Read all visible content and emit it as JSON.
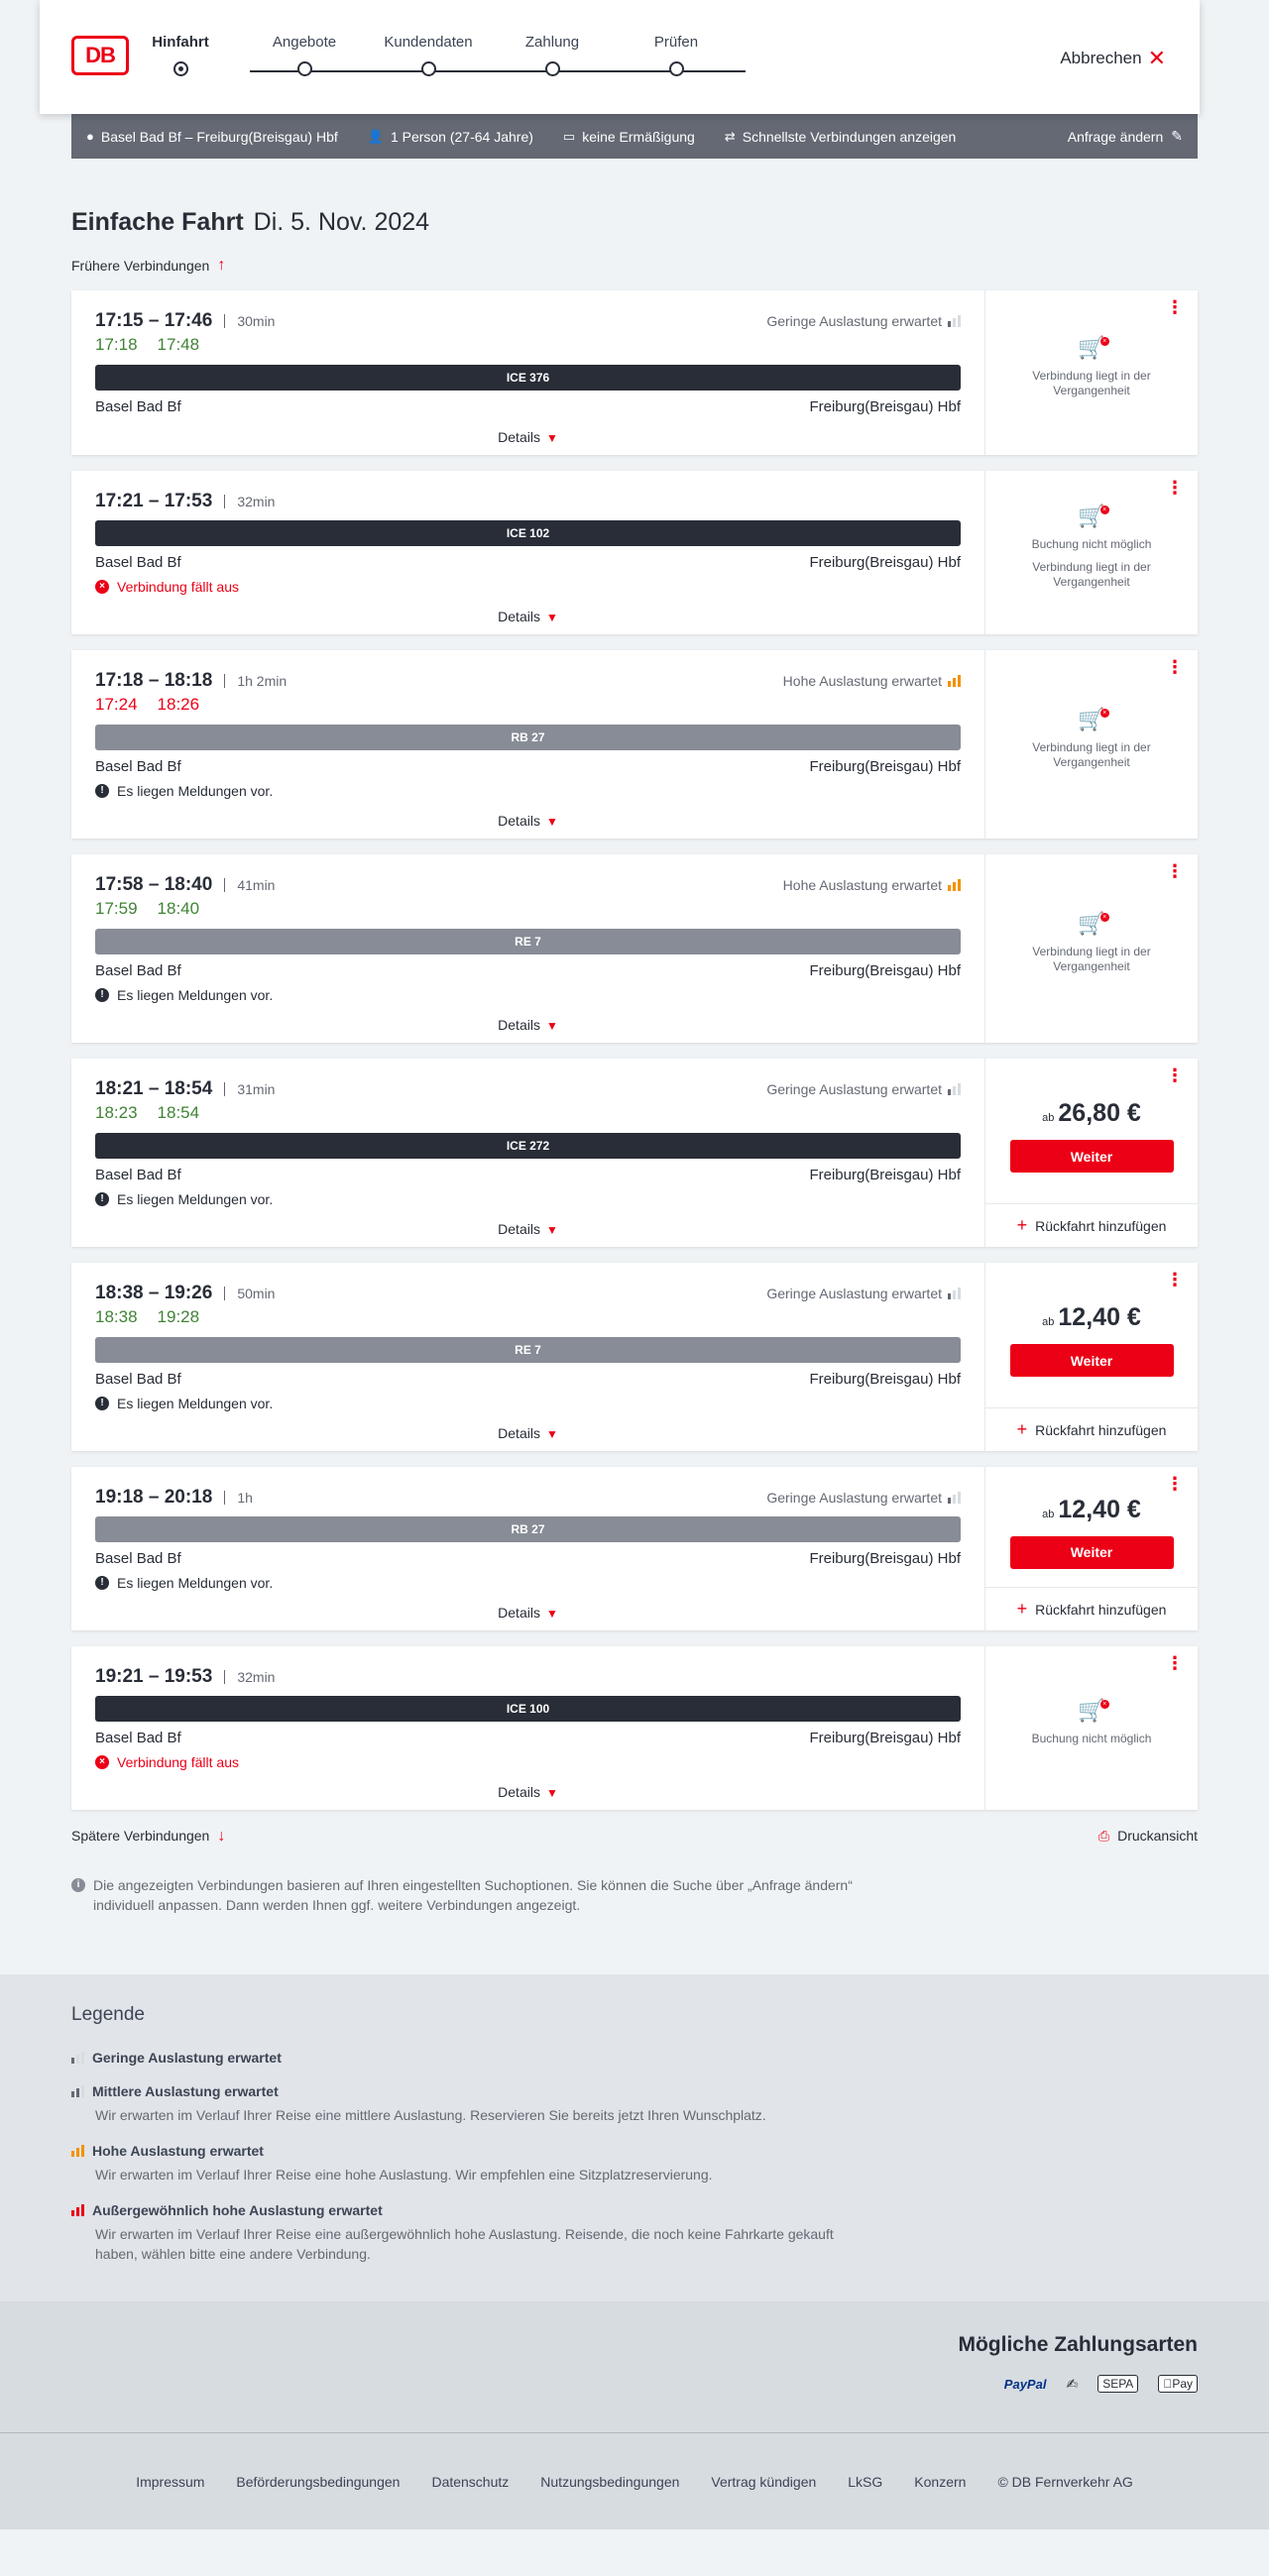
{
  "header": {
    "logo": "DB",
    "steps": [
      "Hinfahrt",
      "Angebote",
      "Kundendaten",
      "Zahlung",
      "Prüfen"
    ],
    "active_step": 0,
    "cancel_label": "Abbrechen"
  },
  "searchbar": {
    "route": "Basel Bad Bf – Freiburg(Breisgau) Hbf",
    "passengers": "1 Person (27-64 Jahre)",
    "discount": "keine Ermäßigung",
    "fastest": "Schnellste Verbindungen anzeigen",
    "change": "Anfrage ändern"
  },
  "title": {
    "type": "Einfache Fahrt",
    "date": "Di. 5. Nov. 2024"
  },
  "earlier_label": "Frühere Verbindungen",
  "later_label": "Spätere Verbindungen",
  "print_label": "Druckansicht",
  "connections": [
    {
      "times": "17:15 – 17:46",
      "duration": "30min",
      "load": "Geringe Auslastung erwartet",
      "load_level": "low",
      "rt_status": "ok",
      "rt_dep": "17:18",
      "rt_arr": "17:48",
      "train": "ICE 376",
      "train_type": "ice",
      "from": "Basel Bad Bf",
      "to": "Freiburg(Breisgau) Hbf",
      "notice": "",
      "notice_type": "",
      "details": "Details",
      "status_lines": [
        "Verbindung liegt in der Vergangenheit"
      ],
      "price": "",
      "price_prefix": "",
      "button": "",
      "return_label": ""
    },
    {
      "times": "17:21 – 17:53",
      "duration": "32min",
      "load": "",
      "load_level": "",
      "rt_status": "",
      "rt_dep": "",
      "rt_arr": "",
      "train": "ICE 102",
      "train_type": "ice",
      "from": "Basel Bad Bf",
      "to": "Freiburg(Breisgau) Hbf",
      "notice": "Verbindung fällt aus",
      "notice_type": "cancel",
      "details": "Details",
      "status_lines": [
        "Buchung nicht möglich",
        "Verbindung liegt in der Vergangenheit"
      ],
      "price": "",
      "price_prefix": "",
      "button": "",
      "return_label": ""
    },
    {
      "times": "17:18 – 18:18",
      "duration": "1h 2min",
      "load": "Hohe Auslastung erwartet",
      "load_level": "high",
      "rt_status": "late",
      "rt_dep": "17:24",
      "rt_arr": "18:26",
      "train": "RB 27",
      "train_type": "reg",
      "from": "Basel Bad Bf",
      "to": "Freiburg(Breisgau) Hbf",
      "notice": "Es liegen Meldungen vor.",
      "notice_type": "info",
      "details": "Details",
      "status_lines": [
        "Verbindung liegt in der Vergangenheit"
      ],
      "price": "",
      "price_prefix": "",
      "button": "",
      "return_label": ""
    },
    {
      "times": "17:58 – 18:40",
      "duration": "41min",
      "load": "Hohe Auslastung erwartet",
      "load_level": "high",
      "rt_status": "ok",
      "rt_dep": "17:59",
      "rt_arr": "18:40",
      "train": "RE 7",
      "train_type": "reg",
      "from": "Basel Bad Bf",
      "to": "Freiburg(Breisgau) Hbf",
      "notice": "Es liegen Meldungen vor.",
      "notice_type": "info",
      "details": "Details",
      "status_lines": [
        "Verbindung liegt in der Vergangenheit"
      ],
      "price": "",
      "price_prefix": "",
      "button": "",
      "return_label": ""
    },
    {
      "times": "18:21 – 18:54",
      "duration": "31min",
      "load": "Geringe Auslastung erwartet",
      "load_level": "low",
      "rt_status": "ok",
      "rt_dep": "18:23",
      "rt_arr": "18:54",
      "train": "ICE 272",
      "train_type": "ice",
      "from": "Basel Bad Bf",
      "to": "Freiburg(Breisgau) Hbf",
      "notice": "Es liegen Meldungen vor.",
      "notice_type": "info",
      "details": "Details",
      "status_lines": [],
      "price": "26,80 €",
      "price_prefix": "ab",
      "button": "Weiter",
      "return_label": "Rückfahrt hinzufügen"
    },
    {
      "times": "18:38 – 19:26",
      "duration": "50min",
      "load": "Geringe Auslastung erwartet",
      "load_level": "low",
      "rt_status": "ok",
      "rt_dep": "18:38",
      "rt_arr": "19:28",
      "train": "RE 7",
      "train_type": "reg",
      "from": "Basel Bad Bf",
      "to": "Freiburg(Breisgau) Hbf",
      "notice": "Es liegen Meldungen vor.",
      "notice_type": "info",
      "details": "Details",
      "status_lines": [],
      "price": "12,40 €",
      "price_prefix": "ab",
      "button": "Weiter",
      "return_label": "Rückfahrt hinzufügen"
    },
    {
      "times": "19:18 – 20:18",
      "duration": "1h",
      "load": "Geringe Auslastung erwartet",
      "load_level": "low",
      "rt_status": "",
      "rt_dep": "",
      "rt_arr": "",
      "train": "RB 27",
      "train_type": "reg",
      "from": "Basel Bad Bf",
      "to": "Freiburg(Breisgau) Hbf",
      "notice": "Es liegen Meldungen vor.",
      "notice_type": "info",
      "details": "Details",
      "status_lines": [],
      "price": "12,40 €",
      "price_prefix": "ab",
      "button": "Weiter",
      "return_label": "Rückfahrt hinzufügen"
    },
    {
      "times": "19:21 – 19:53",
      "duration": "32min",
      "load": "",
      "load_level": "",
      "rt_status": "",
      "rt_dep": "",
      "rt_arr": "",
      "train": "ICE 100",
      "train_type": "ice",
      "from": "Basel Bad Bf",
      "to": "Freiburg(Breisgau) Hbf",
      "notice": "Verbindung fällt aus",
      "notice_type": "cancel",
      "details": "Details",
      "status_lines": [
        "Buchung nicht möglich"
      ],
      "price": "",
      "price_prefix": "",
      "button": "",
      "return_label": ""
    }
  ],
  "hint": "Die angezeigten Verbindungen basieren auf Ihren eingestellten Suchoptionen. Sie können die Suche über „Anfrage ändern“ individuell anpassen. Dann werden Ihnen ggf. weitere Verbindungen angezeigt.",
  "legend": {
    "title": "Legende",
    "items": [
      {
        "title": "Geringe Auslastung erwartet",
        "desc": "",
        "level": "low"
      },
      {
        "title": "Mittlere Auslastung erwartet",
        "desc": "Wir erwarten im Verlauf Ihrer Reise eine mittlere Auslastung. Reservieren Sie bereits jetzt Ihren Wunschplatz.",
        "level": "mid"
      },
      {
        "title": "Hohe Auslastung erwartet",
        "desc": "Wir erwarten im Verlauf Ihrer Reise eine hohe Auslastung. Wir empfehlen eine Sitzplatzreservierung.",
        "level": "high"
      },
      {
        "title": "Außergewöhnlich hohe Auslastung erwartet",
        "desc": "Wir erwarten im Verlauf Ihrer Reise eine außergewöhnlich hohe Auslastung. Reisende, die noch keine Fahrkarte gekauft haben, wählen bitte eine andere Verbindung.",
        "level": "extreme"
      }
    ]
  },
  "payment": {
    "title": "Mögliche Zahlungsarten",
    "methods": [
      "PayPal",
      "SEPA",
      "Pay"
    ]
  },
  "footer": [
    "Impressum",
    "Beförderungsbedingungen",
    "Datenschutz",
    "Nutzungsbedingungen",
    "Vertrag kündigen",
    "LkSG",
    "Konzern",
    "© DB Fernverkehr AG"
  ],
  "colors": {
    "accent": "#ec0016",
    "ok": "#408335",
    "high_load": "#f39200",
    "dark": "#282d37"
  }
}
